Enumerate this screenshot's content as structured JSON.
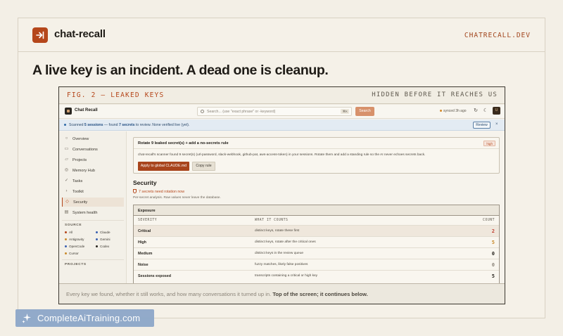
{
  "header": {
    "brand": "chat-recall",
    "site": "CHATRECALL.DEV"
  },
  "headline": "A live key is an incident. A dead one is cleanup.",
  "figure": {
    "title": "FIG. 2 — LEAKED KEYS",
    "subtitle": "HIDDEN BEFORE IT REACHES US"
  },
  "app": {
    "name": "Chat Recall",
    "search": {
      "placeholder": "Search... (use \"exact phrase\" or -keyword)",
      "shortcut": "⌘K",
      "button": "Search"
    },
    "sync_status": "synced 3h ago",
    "avatar": "U"
  },
  "banner": {
    "prefix": "Scanned ",
    "sessions": "5 sessions",
    "middle": " — found ",
    "secrets": "7 secrets",
    "suffix": " to review. None verified live (yet).",
    "review": "Review",
    "close": "×"
  },
  "sidebar": {
    "items": [
      {
        "label": "Overview",
        "icon": "○"
      },
      {
        "label": "Conversations",
        "icon": "▭"
      },
      {
        "label": "Projects",
        "icon": "▱"
      },
      {
        "label": "Memory Hub",
        "icon": "◎"
      },
      {
        "label": "Tasks",
        "icon": "✓"
      },
      {
        "label": "Toolkit",
        "icon": "›"
      },
      {
        "label": "Security",
        "icon": "◇"
      },
      {
        "label": "System health",
        "icon": "▤"
      }
    ],
    "source_label": "SOURCE",
    "sources": [
      {
        "label": "All",
        "color": "#b5471b"
      },
      {
        "label": "Claude",
        "color": "#3a5fb0"
      },
      {
        "label": "Antigravity",
        "color": "#c98a2b"
      },
      {
        "label": "Gemini",
        "color": "#3a5fb0"
      },
      {
        "label": "OpenCode",
        "color": "#3a5fb0"
      },
      {
        "label": "Codex",
        "color": "#2a2620"
      },
      {
        "label": "Cursor",
        "color": "#c98a2b"
      }
    ],
    "projects_label": "PROJECTS"
  },
  "rule_card": {
    "title": "Rotate 9 leaked secret(s) + add a no-secrets rule",
    "badge": "high",
    "description": "chat-recall's scanner found 9 secret(s) (url-password, slack-webhook, github-pat, aws-access-token) in your sessions. Rotate them and add a standing rule so the AI never echoes secrets back.",
    "apply_button": "Apply to global CLAUDE.md",
    "copy_button": "Copy rule"
  },
  "security": {
    "title": "Security",
    "alert": "7 secrets need rotation now",
    "note": "Per-secret analysis. Raw values never leave the database."
  },
  "exposure": {
    "title": "Exposure",
    "columns": [
      "SEVERITY",
      "WHAT IT COUNTS",
      "COUNT"
    ],
    "rows": [
      {
        "severity": "Critical",
        "what": "distinct keys, rotate these first",
        "count": "2",
        "color": "#c0392b"
      },
      {
        "severity": "High",
        "what": "distinct keys, rotate after the critical ones",
        "count": "5",
        "color": "#c98a2b"
      },
      {
        "severity": "Medium",
        "what": "distinct keys in the review queue",
        "count": "0",
        "color": "#2a2620"
      },
      {
        "severity": "Noise",
        "what": "fuzzy matches, likely false positives",
        "count": "0",
        "color": "#8c857a"
      },
      {
        "severity": "Sessions exposed",
        "what": "transcripts containing a critical or high key",
        "count": "5",
        "color": "#2a2620"
      }
    ]
  },
  "caption": {
    "text": "Every key we found, whether it still works, and how many conversations it turned up in. ",
    "bold": "Top of the screen; it continues below."
  },
  "watermark": "CompleteAiTraining.com",
  "colors": {
    "accent": "#b5471b",
    "background": "#f3efe6",
    "info": "#2f6aa8"
  }
}
